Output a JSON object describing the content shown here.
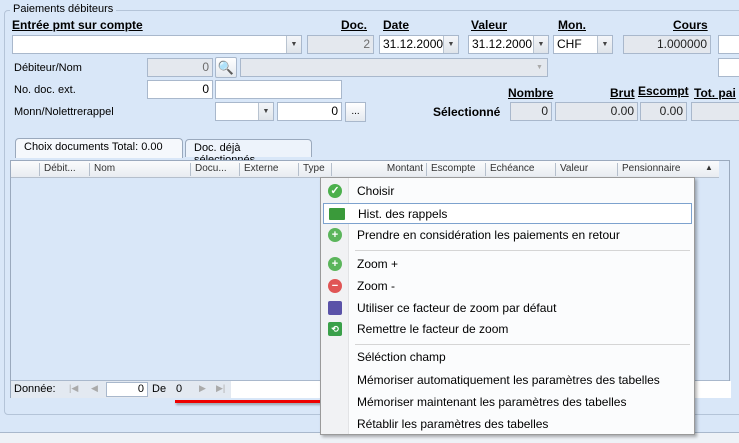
{
  "group_title": "Paiements débiteurs",
  "headers": {
    "entree": "Entrée pmt sur compte",
    "doc": "Doc.",
    "date": "Date",
    "valeur": "Valeur",
    "mon": "Mon.",
    "cours": "Cours"
  },
  "row1": {
    "entree_value": "",
    "doc_value": "2",
    "date_value": "31.12.2000",
    "valeur_value": "31.12.2000",
    "mon_value": "CHF",
    "cours_value": "1.000000"
  },
  "debiteur": {
    "label": "Débiteur/Nom",
    "number": "0",
    "name": ""
  },
  "nodoc": {
    "label": "No. doc. ext.",
    "number": "0",
    "text": ""
  },
  "monn": {
    "label": "Monn/Nolettrerappel",
    "select": "",
    "number": "0",
    "more": "..."
  },
  "summary": {
    "nombre": "Nombre",
    "brut": "Brut",
    "escompt": "Escompt",
    "tot": "Tot. pai",
    "selected_label": "Sélectionné",
    "nombre_value": "0",
    "brut_value": "0.00",
    "escompt_value": "0.00"
  },
  "tabs": [
    {
      "label": "Choix documents Total:  0.00"
    },
    {
      "label": "Doc. déjà sélectionnés"
    }
  ],
  "columns": [
    "Débit...",
    "Nom",
    "Docu...",
    "Externe",
    "Type",
    "Montant",
    "Escompte",
    "Echéance",
    "Valeur",
    "Pensionnaire"
  ],
  "footer": {
    "label": "Donnée:",
    "current": "0",
    "of": "De",
    "total": "0"
  },
  "menu": [
    {
      "label": "Choisir",
      "icon": "check-icon"
    },
    {
      "label": "Hist. des rappels",
      "icon": "history-icon"
    },
    {
      "label": "Prendre en considération les paiements en retour",
      "icon": "plus-icon"
    },
    {
      "label": "Zoom +",
      "icon": "zoom-in-icon"
    },
    {
      "label": "Zoom -",
      "icon": "zoom-out-icon"
    },
    {
      "label": "Utiliser ce facteur de zoom par défaut",
      "icon": "save-icon"
    },
    {
      "label": "Remettre le facteur de zoom",
      "icon": "reset-icon"
    },
    {
      "label": "Séléction champ"
    },
    {
      "label": "Mémoriser automatiquement les paramètres des tabelles"
    },
    {
      "label": "Mémoriser maintenant les paramètres des tabelles"
    },
    {
      "label": "Rétablir les paramètres des tabelles"
    }
  ]
}
